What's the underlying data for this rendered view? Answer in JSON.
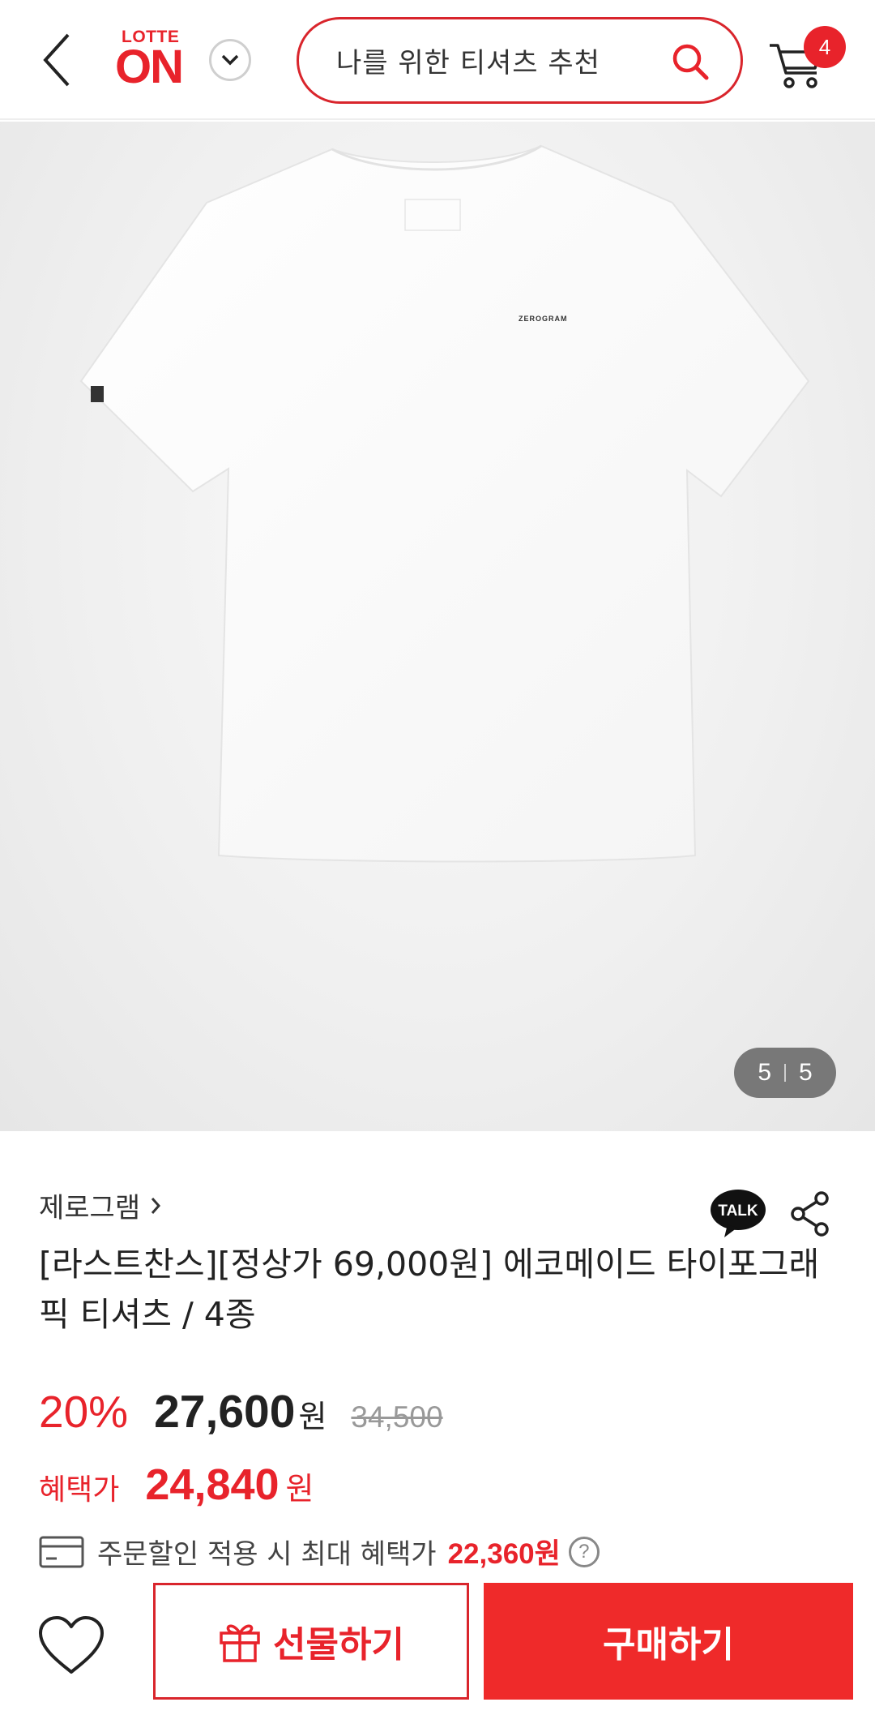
{
  "header": {
    "logo_top": "LOTTE",
    "logo_main": "ON",
    "search_text": "나를 위한 티셔츠 추천",
    "cart_count": "4"
  },
  "gallery": {
    "current": "5",
    "total": "5",
    "shirt_logo_text": "ZEROGRAM"
  },
  "product": {
    "brand": "제로그램",
    "title": "[라스트찬스][정상가 69,000원] 에코메이드 타이포그래픽 티셔츠 / 4종",
    "discount_rate": "20%",
    "price": "27,600",
    "price_unit": "원",
    "original_price": "34,500",
    "benefit_label": "혜택가",
    "benefit_price": "24,840",
    "benefit_unit": "원",
    "max_benefit_text": "주문할인 적용 시 최대 혜택가",
    "max_benefit_amount": "22,360원",
    "help_symbol": "?"
  },
  "actions": {
    "talk_label": "TALK",
    "gift_label": "선물하기",
    "buy_label": "구매하기"
  },
  "colors": {
    "accent": "#e8232b",
    "buy_button": "#ef2a2a"
  }
}
